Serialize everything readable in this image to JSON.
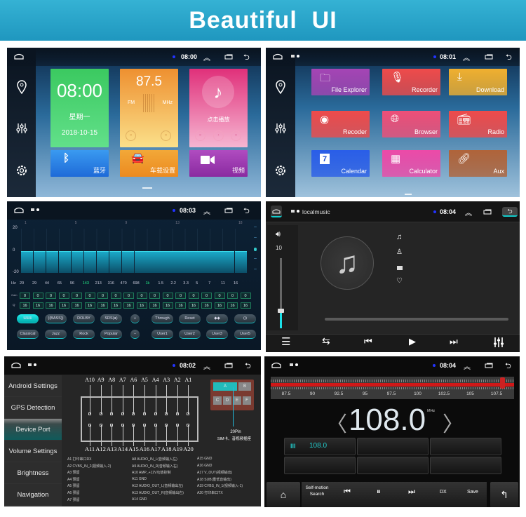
{
  "banner": {
    "title": "Beautiful  UI",
    "color": "#2aa5cc"
  },
  "home": {
    "status_time": "08:00",
    "sidebar_icons": [
      "location-icon",
      "equalizer-icon",
      "settings-icon"
    ],
    "clock_tile": {
      "time": "08:00",
      "weekday": "星期一",
      "date": "2018-10-15",
      "color": "#3fcf6a"
    },
    "radio_tile": {
      "freq": "87.5",
      "band": "FM",
      "unit": "MHz",
      "color": "#f0a040"
    },
    "music_tile": {
      "label": "点击播放",
      "color": "#e85a95"
    },
    "bluetooth_tile": {
      "label": "蓝牙",
      "color": "#2f86e6"
    },
    "car_settings_tile": {
      "label": "车载设置",
      "color": "#f0a030"
    },
    "video_tile": {
      "label": "视频",
      "color": "#a23fb0"
    }
  },
  "apps": {
    "status_time": "08:01",
    "tiles": [
      {
        "label": "File Explorer",
        "icon": "folder-icon",
        "color": "#a545b5"
      },
      {
        "label": "Recorder",
        "icon": "microphone-icon",
        "color": "#ef4b4b"
      },
      {
        "label": "Download",
        "icon": "download-icon",
        "color": "#f0b030"
      },
      {
        "label": "Recoder",
        "icon": "record-icon",
        "color": "#ef4b4b"
      },
      {
        "label": "Browser",
        "icon": "globe-icon",
        "color": "#ef4f78"
      },
      {
        "label": "Radio",
        "icon": "radio-icon",
        "color": "#ef4b4b"
      },
      {
        "label": "Calendar",
        "icon": "calendar-icon",
        "color": "#2a5ee8",
        "day": "7"
      },
      {
        "label": "Calculator",
        "icon": "calculator-icon",
        "color": "#ec4aa8"
      },
      {
        "label": "Aux",
        "icon": "link-icon",
        "color": "#b0643a"
      }
    ]
  },
  "equalizer": {
    "status_time": "08:03",
    "band_index_labels": [
      "1",
      "5",
      "9",
      "13",
      "18"
    ],
    "y_labels": [
      "20",
      "0",
      "-20"
    ],
    "hz_label": "Hz",
    "frequencies": [
      "20",
      "29",
      "44",
      "65",
      "96",
      "143",
      "213",
      "316",
      "470",
      "698",
      "1k",
      "1.5",
      "2.2",
      "3.3",
      "5",
      "7",
      "11",
      "16"
    ],
    "highlighted": [
      "143",
      "1k"
    ],
    "gain_label": "Gain",
    "gains": [
      0,
      0,
      0,
      0,
      0,
      0,
      0,
      0,
      0,
      0,
      0,
      0,
      0,
      0,
      0,
      0,
      0,
      0
    ],
    "q_label": "Q",
    "q_values": [
      16,
      16,
      16,
      16,
      16,
      16,
      16,
      16,
      16,
      16,
      16,
      16,
      16,
      16,
      16,
      16,
      16,
      16
    ],
    "gain_range": [
      -20,
      20
    ],
    "buttons_row1": [
      "ᗯᗯᗯ",
      "((BASS))",
      "DOLBY",
      "SRS(●)",
      "+",
      "Through",
      "Reset",
      "◆◆",
      "(i)"
    ],
    "buttons_row2": [
      "Classical",
      "Jazz",
      "Rock",
      "Popular",
      "−",
      "User1",
      "User2",
      "User3",
      "User5"
    ]
  },
  "music": {
    "status_time": "08:04",
    "app_title": "localmusic",
    "volume": 10,
    "volume_max": 40,
    "info_icons": [
      "note-icon",
      "artist-icon",
      "folder-icon",
      "heart-icon"
    ],
    "progress": 0,
    "controls": [
      "playlist-icon",
      "repeat-icon",
      "previous-icon",
      "play-icon",
      "next-icon",
      "equalizer-icon"
    ]
  },
  "device": {
    "status_time": "08:02",
    "menu": [
      "Android Settings",
      "GPS Detection",
      "Device Port",
      "Volume Settings",
      "Brightness",
      "Navigation"
    ],
    "selected": "Device Port",
    "top_pins": [
      "A10",
      "A9",
      "A8",
      "A7",
      "A6",
      "A5",
      "A4",
      "A3",
      "A2",
      "A1"
    ],
    "bottom_pins": [
      "A11",
      "A12",
      "A13",
      "A14",
      "A15",
      "A16",
      "A17",
      "A18",
      "A19",
      "A20"
    ],
    "connector_labels": [
      "A",
      "B",
      "C",
      "D",
      "E",
      "F"
    ],
    "connector_caption1": "20Pin",
    "connector_caption2": "SIM卡、音视频插座",
    "pin_list": [
      [
        "A1  打印串口RX",
        "A2  CVBS_IN_2(视频输入-2)",
        "A3  预留",
        "A4  预留",
        "A5  预留",
        "A6  预留",
        "A7  预留"
      ],
      [
        "A8  AUDIO_IN_L(音频输入左)",
        "A9  AUDIO_IN_R(音频输入右)",
        "A10 AMP_+12V功放控制",
        "A11 GND",
        "A12 AUDIO_OUT_L(音频输出左)",
        "A13 AUDIO_OUT_R(音频输出右)",
        "A14 GND"
      ],
      [
        "A15 GND",
        "A16 GND",
        "A17 V_OUT(视频输出)",
        "A18 SUB(重低音输出)",
        "A19 CVBS_IN_1(视频输入-1)",
        "A20 打印串口TX"
      ]
    ]
  },
  "radio": {
    "status_time": "08:04",
    "scale_labels": [
      "87.5",
      "90",
      "92.5",
      "95",
      "97.5",
      "100",
      "102.5",
      "105",
      "107.5"
    ],
    "frequency": "108.0",
    "unit": "MHz",
    "scale_range": [
      87.5,
      108.0
    ],
    "presets": [
      "108.0",
      "",
      "",
      "",
      "",
      ""
    ],
    "controls": {
      "search": "Self-motion Search",
      "dx": "DX",
      "save": "Save"
    }
  }
}
